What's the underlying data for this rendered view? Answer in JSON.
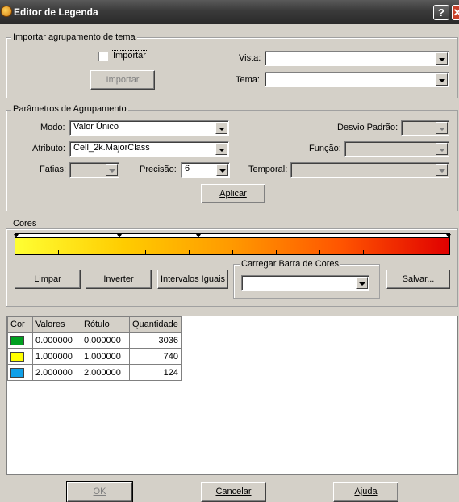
{
  "window": {
    "title": "Editor de Legenda",
    "help": "?",
    "close": "✕"
  },
  "importar_group": {
    "title": "Importar agrupamento de tema",
    "checkbox_label": "Importar",
    "button_label": "Importar",
    "vista_label": "Vista:",
    "vista_value": "",
    "tema_label": "Tema:",
    "tema_value": ""
  },
  "params_group": {
    "title": "Parâmetros de Agrupamento",
    "modo_label": "Modo:",
    "modo_value": "Valor Único",
    "desvio_label": "Desvio Padrão:",
    "desvio_value": "",
    "atributo_label": "Atributo:",
    "atributo_value": "Cell_2k.MajorClass",
    "funcao_label": "Função:",
    "funcao_value": "",
    "fatias_label": "Fatias:",
    "fatias_value": "",
    "precisao_label": "Precisão:",
    "precisao_value": "6",
    "temporal_label": "Temporal:",
    "temporal_value": "",
    "aplicar_label": "Aplicar"
  },
  "cores_group": {
    "title": "Cores",
    "limpar": "Limpar",
    "inverter": "Inverter",
    "intervalos": "Intervalos Iguais",
    "carregar_title": "Carregar Barra de Cores",
    "carregar_value": "",
    "salvar": "Salvar...",
    "gradient_colors": [
      "#ffff33",
      "#ffcc00",
      "#ff9900",
      "#ff5500",
      "#e00000"
    ]
  },
  "table": {
    "headers": [
      "Cor",
      "Valores",
      "Rótulo",
      "Quantidade"
    ],
    "rows": [
      {
        "color": "#00a020",
        "valor": "0.000000",
        "rotulo": "0.000000",
        "quantidade": "3036"
      },
      {
        "color": "#ffff00",
        "valor": "1.000000",
        "rotulo": "1.000000",
        "quantidade": "740"
      },
      {
        "color": "#10a0e8",
        "valor": "2.000000",
        "rotulo": "2.000000",
        "quantidade": "124"
      }
    ]
  },
  "footer": {
    "ok": "OK",
    "cancelar": "Cancelar",
    "ajuda": "Ajuda"
  }
}
